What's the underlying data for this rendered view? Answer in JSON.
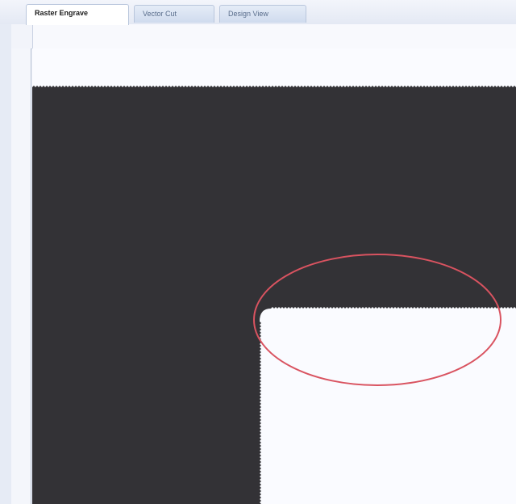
{
  "tabs": [
    {
      "label": "Raster Engrave",
      "active": true
    },
    {
      "label": "Vector Cut",
      "active": false
    },
    {
      "label": "Design View",
      "active": false
    }
  ],
  "colors": {
    "engrave_fill": "#333236",
    "canvas_background": "#fafbff",
    "highlight_ellipse": "#d95360",
    "tab_border": "#b9c6dc"
  },
  "canvas": {
    "icons": [
      "raster-engraved-shape",
      "highlight-ellipse"
    ]
  }
}
